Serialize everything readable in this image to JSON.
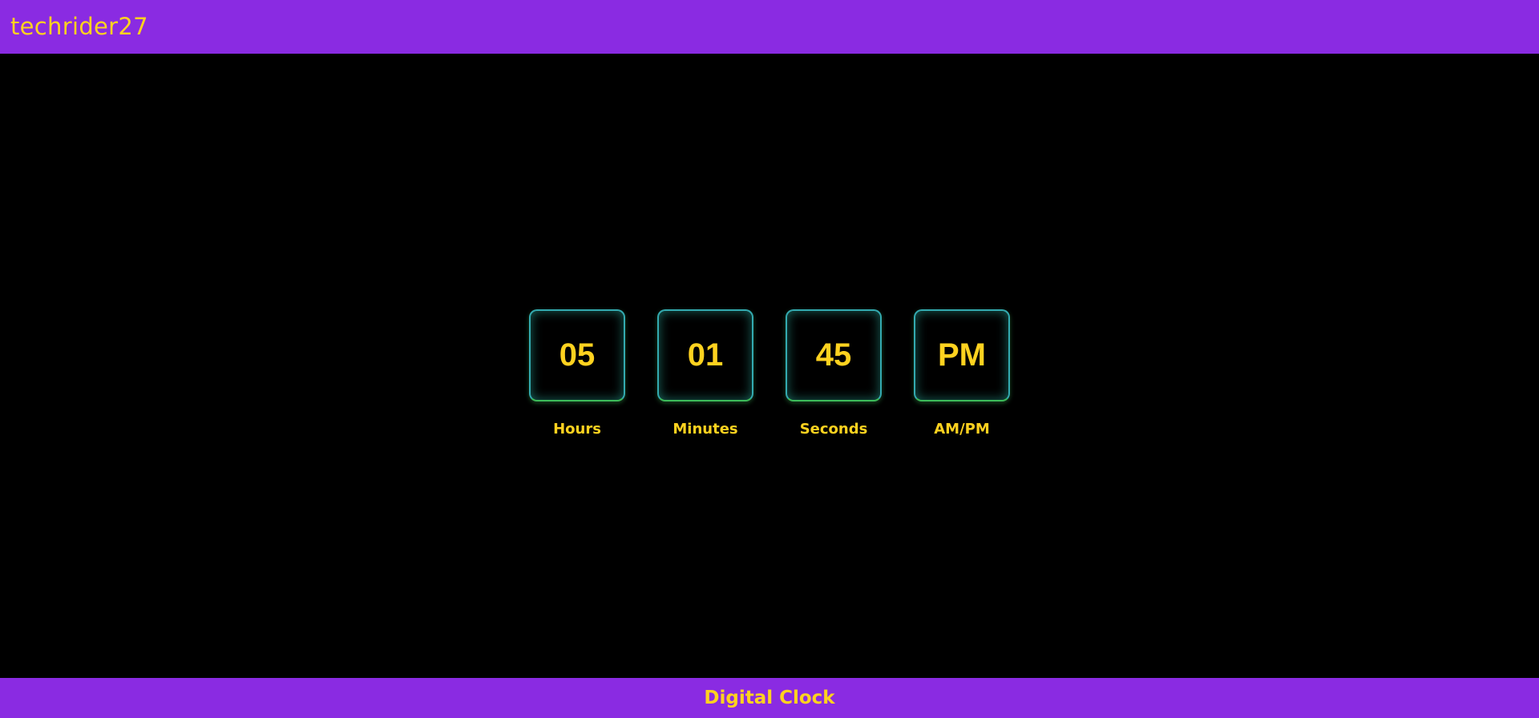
{
  "header": {
    "brand": "techrider27"
  },
  "clock": {
    "units": [
      {
        "value": "05",
        "label": "Hours"
      },
      {
        "value": "01",
        "label": "Minutes"
      },
      {
        "value": "45",
        "label": "Seconds"
      },
      {
        "value": "PM",
        "label": "AM/PM"
      }
    ]
  },
  "footer": {
    "title": "Digital Clock"
  },
  "colors": {
    "header_bg": "#8a2be2",
    "text_accent": "#ffd21f",
    "background": "#000000",
    "box_border": "#33aab0",
    "box_glow": "#3dbb5a"
  }
}
